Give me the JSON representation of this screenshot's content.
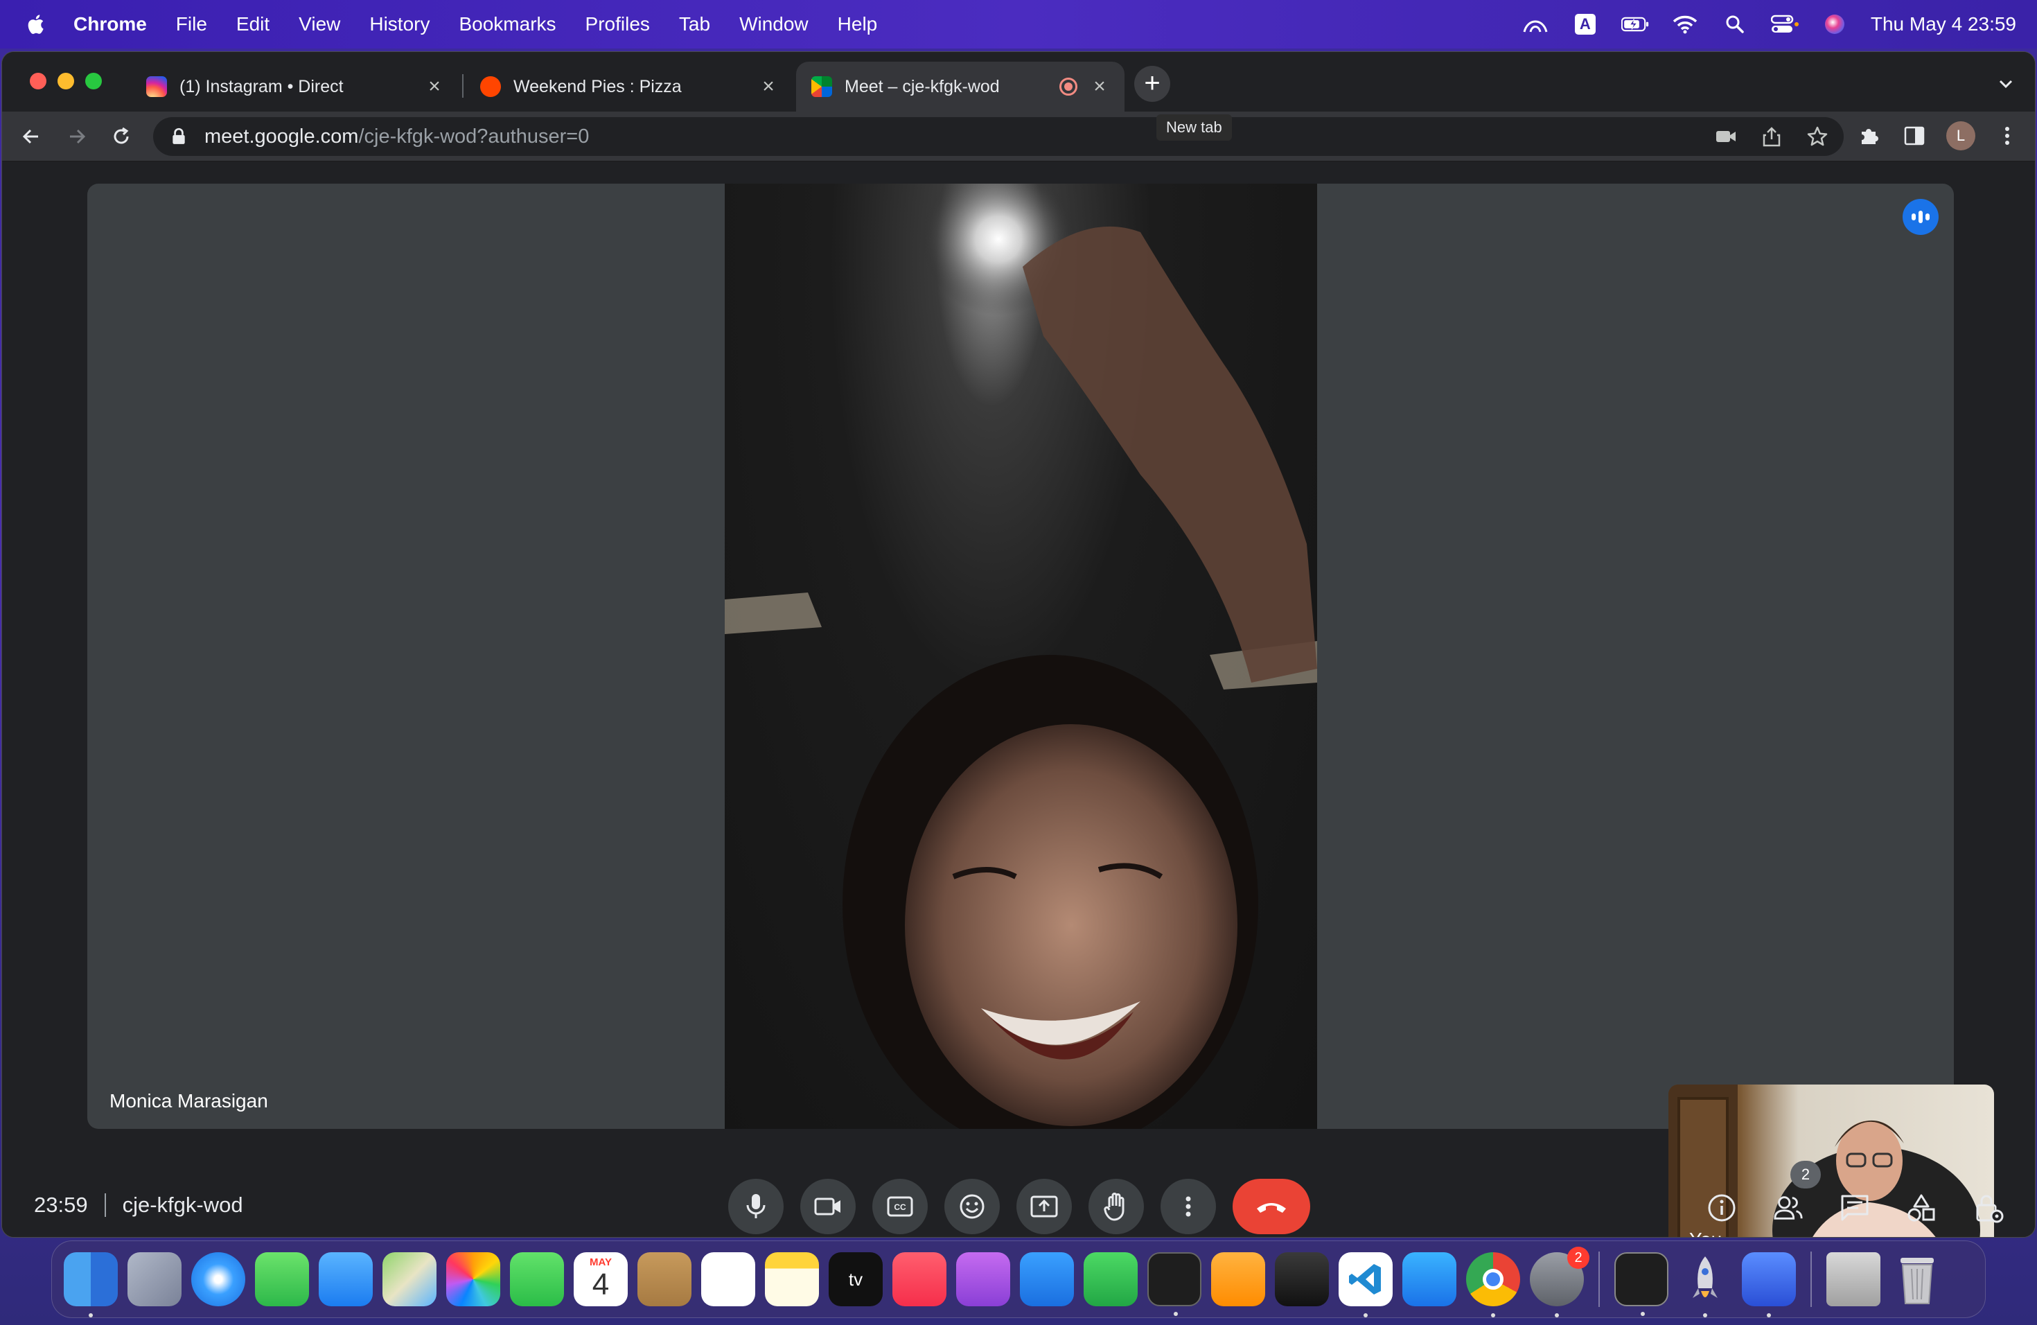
{
  "menubar": {
    "app_name": "Chrome",
    "items": [
      "File",
      "Edit",
      "View",
      "History",
      "Bookmarks",
      "Profiles",
      "Tab",
      "Window",
      "Help"
    ],
    "input_source": "A",
    "clock": "Thu May 4  23:59"
  },
  "browser": {
    "tabs": [
      {
        "title": "(1) Instagram • Direct",
        "favicon": "instagram-icon"
      },
      {
        "title": "Weekend Pies : Pizza",
        "favicon": "reddit-icon"
      },
      {
        "title": "Meet – cje-kfgk-wod",
        "favicon": "google-meet-icon",
        "active": true,
        "recording": true
      }
    ],
    "new_tab_tooltip": "New tab",
    "url_host": "meet.google.com",
    "url_path": "/cje-kfgk-wod?authuser=0",
    "profile_initial": "L"
  },
  "meet": {
    "participant_name": "Monica Marasigan",
    "self_label": "You",
    "time": "23:59",
    "meeting_code": "cje-kfgk-wod",
    "people_count": "2",
    "end_call_color": "#ea4335",
    "accent_color": "#1a73e8"
  },
  "dock": {
    "calendar_month": "MAY",
    "calendar_day": "4",
    "settings_badge": "2",
    "apps": [
      "Finder",
      "Launchpad",
      "Safari",
      "Messages",
      "Mail",
      "Maps",
      "Photos",
      "FaceTime",
      "Calendar",
      "Contacts",
      "Reminders",
      "Notes",
      "TV",
      "Music",
      "Podcasts",
      "Keynote",
      "Numbers",
      "Terminal",
      "Pages",
      "GarageBand",
      "Visual Studio Code",
      "App Store",
      "Google Chrome",
      "System Settings",
      "Terminal",
      "Rocket",
      "Nightshift",
      "Downloads",
      "Trash"
    ]
  }
}
